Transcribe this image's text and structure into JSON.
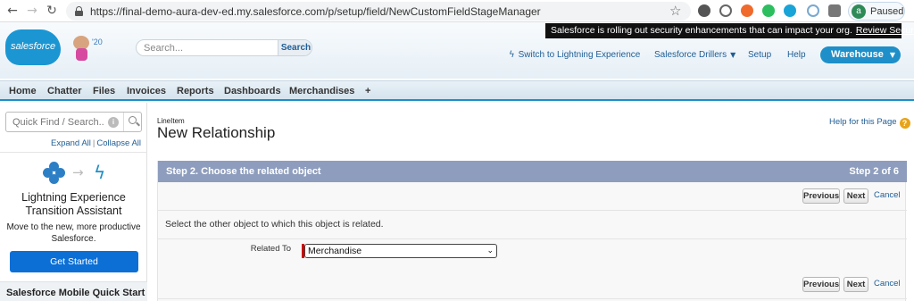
{
  "browser": {
    "url": "https://final-demo-aura-dev-ed.my.salesforce.com/p/setup/field/NewCustomFieldStageManager",
    "profile_initial": "a",
    "profile_status": "Paused"
  },
  "header": {
    "logo_text": "salesforce",
    "mascot_year": "'20",
    "search_placeholder": "Search...",
    "search_button": "Search",
    "alert_text": "Salesforce is rolling out security enhancements that can impact your org.",
    "alert_link": "Review Security Alert",
    "switch_lightning": "Switch to Lightning Experience",
    "user_menu": "Salesforce Drillers",
    "setup": "Setup",
    "help": "Help",
    "app_menu": "Warehouse"
  },
  "tabs": [
    "Home",
    "Chatter",
    "Files",
    "Invoices",
    "Reports",
    "Dashboards",
    "Merchandises",
    "+"
  ],
  "sidebar": {
    "quick_find_placeholder": "Quick Find / Search...",
    "expand_all": "Expand All",
    "collapse_all": "Collapse All",
    "lea_title_1": "Lightning Experience",
    "lea_title_2": "Transition Assistant",
    "lea_desc_1": "Move to the new, more productive",
    "lea_desc_2": "Salesforce.",
    "get_started": "Get Started",
    "mobile_quick_start": "Salesforce Mobile Quick Start"
  },
  "main": {
    "object_label": "LineItem",
    "page_title": "New Relationship",
    "help_link": "Help for this Page",
    "step_title": "Step 2. Choose the related object",
    "step_count": "Step 2 of 6",
    "previous": "Previous",
    "next": "Next",
    "cancel": "Cancel",
    "instruction": "Select the other object to which this object is related.",
    "related_to_label": "Related To",
    "related_to_value": "Merchandise"
  },
  "colors": {
    "brand_blue": "#1b96d3",
    "step_bar": "#8e9dbd",
    "get_started": "#0b6fd6",
    "required": "#cc0000"
  }
}
